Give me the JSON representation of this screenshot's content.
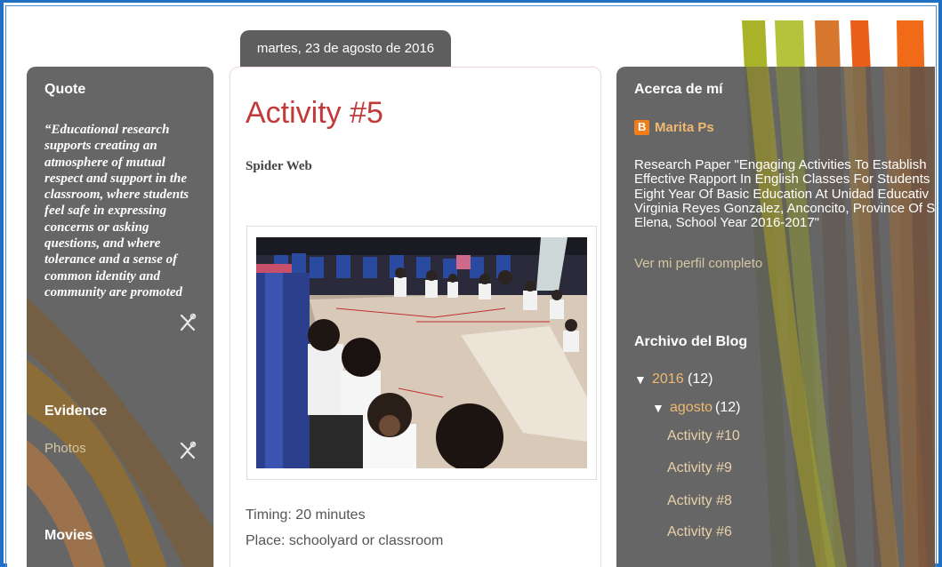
{
  "date_header": "martes, 23 de agosto de 2016",
  "left_sidebar": {
    "quote": {
      "title": "Quote",
      "lines": [
        "“Educational research",
        "supports creating an",
        "atmosphere of mutual",
        "respect and support in the",
        "classroom, where students",
        "feel safe in expressing",
        "concerns or asking",
        "questions, and where",
        "tolerance and a sense of",
        "common identity and",
        "community are promoted"
      ]
    },
    "evidence": {
      "title": "Evidence",
      "link": "Photos"
    },
    "movies": {
      "title": "Movies"
    }
  },
  "post": {
    "title": "Activity #5",
    "subtitle": "Spider Web",
    "body": [
      "Timing: 20 minutes",
      "Place: schoolyard or classroom"
    ]
  },
  "right_sidebar": {
    "about": {
      "title": "Acerca de mí",
      "author": "Marita Ps",
      "bio_lines": [
        "Research Paper \"Engaging Activities To Establish",
        "Effective Rapport In English Classes For Students",
        "Eight Year Of Basic Education At Unidad Educativ",
        "Virginia Reyes Gonzalez, Anconcito, Province Of S",
        "Elena, School Year 2016-2017\""
      ],
      "profile_link": "Ver mi perfil completo"
    },
    "archive": {
      "title": "Archivo del Blog",
      "year": {
        "label": "2016",
        "count": "(12)"
      },
      "month": {
        "label": "agosto",
        "count": "(12)"
      },
      "posts": [
        "Activity #10",
        "Activity #9",
        "Activity #8",
        "Activity #6"
      ]
    }
  },
  "colors": {
    "frame": "#1f6fc4",
    "post_title": "#c13a3a",
    "sidebar_bg": "#5a5a5a",
    "link_light": "#d6c7a0",
    "archive_link": "#f0b870",
    "blogger_icon": "#f07c1a"
  },
  "icons": [
    "tools-icon",
    "blogger-icon",
    "triangle-down-icon"
  ]
}
